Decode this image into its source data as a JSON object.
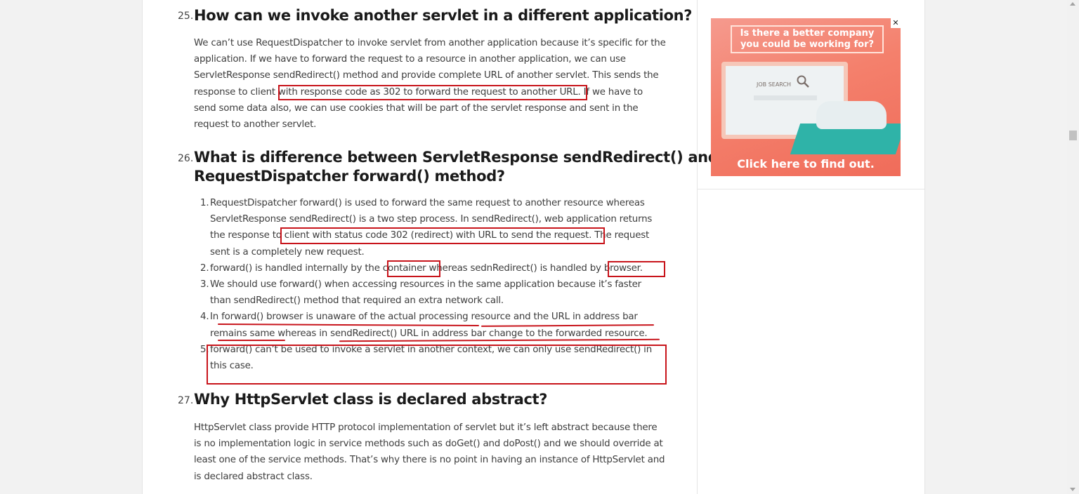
{
  "q25": {
    "number": "25.",
    "title": "How can we invoke another servlet in a different application?",
    "lines": [
      "We can’t use RequestDispatcher to invoke servlet from another application because it’s specific for the",
      "application. If we have to forward the request to a resource in another application, we can use",
      "ServletResponse sendRedirect() method and provide complete URL of another servlet. This sends the",
      "response to client with response code as 302 to forward the request to another URL. If we have to",
      "send some data also, we can use cookies that will be part of the servlet response and sent in the",
      "request to another servlet."
    ]
  },
  "q26": {
    "number": "26.",
    "title_lines": [
      "What is difference between ServletResponse sendRedirect() and",
      "RequestDispatcher forward() method?"
    ],
    "items": [
      {
        "num": "1.",
        "lines": [
          "RequestDispatcher forward() is used to forward the same request to another resource whereas",
          "ServletResponse sendRedirect() is a two step process. In sendRedirect(), web application returns",
          "the response to client with status code 302 (redirect) with URL to send the request. The request",
          "sent is a completely new request."
        ]
      },
      {
        "num": "2.",
        "lines": [
          "forward() is handled internally by the container whereas sednRedirect() is handled by browser."
        ]
      },
      {
        "num": "3.",
        "lines": [
          "We should use forward() when accessing resources in the same application because it’s faster",
          "than sendRedirect() method that required an extra network call."
        ]
      },
      {
        "num": "4.",
        "lines": [
          "In forward() browser is unaware of the actual processing resource and the URL in address bar",
          "remains same whereas in sendRedirect() URL in address bar change to the forwarded resource."
        ]
      },
      {
        "num": "5.",
        "lines": [
          "forward() can’t be used to invoke a servlet in another context, we can only use sendRedirect() in",
          "this case."
        ]
      }
    ]
  },
  "q27": {
    "number": "27.",
    "title": "Why HttpServlet class is declared abstract?",
    "lines": [
      "HttpServlet class provide HTTP protocol implementation of servlet but it’s left abstract because there",
      "is no implementation logic in service methods such as doGet() and doPost() and we should override at",
      "least one of the service methods. That’s why there is no point in having an instance of HttpServlet and",
      "is declared abstract class."
    ]
  },
  "ad": {
    "headline": "Is there a better company you could be working for?",
    "screen_text": "JOB SEARCH",
    "cta": "Click here to find out.",
    "close": "✕"
  },
  "colors": {
    "annotation_red": "#c8141b",
    "ad_background": "#f4806c"
  }
}
